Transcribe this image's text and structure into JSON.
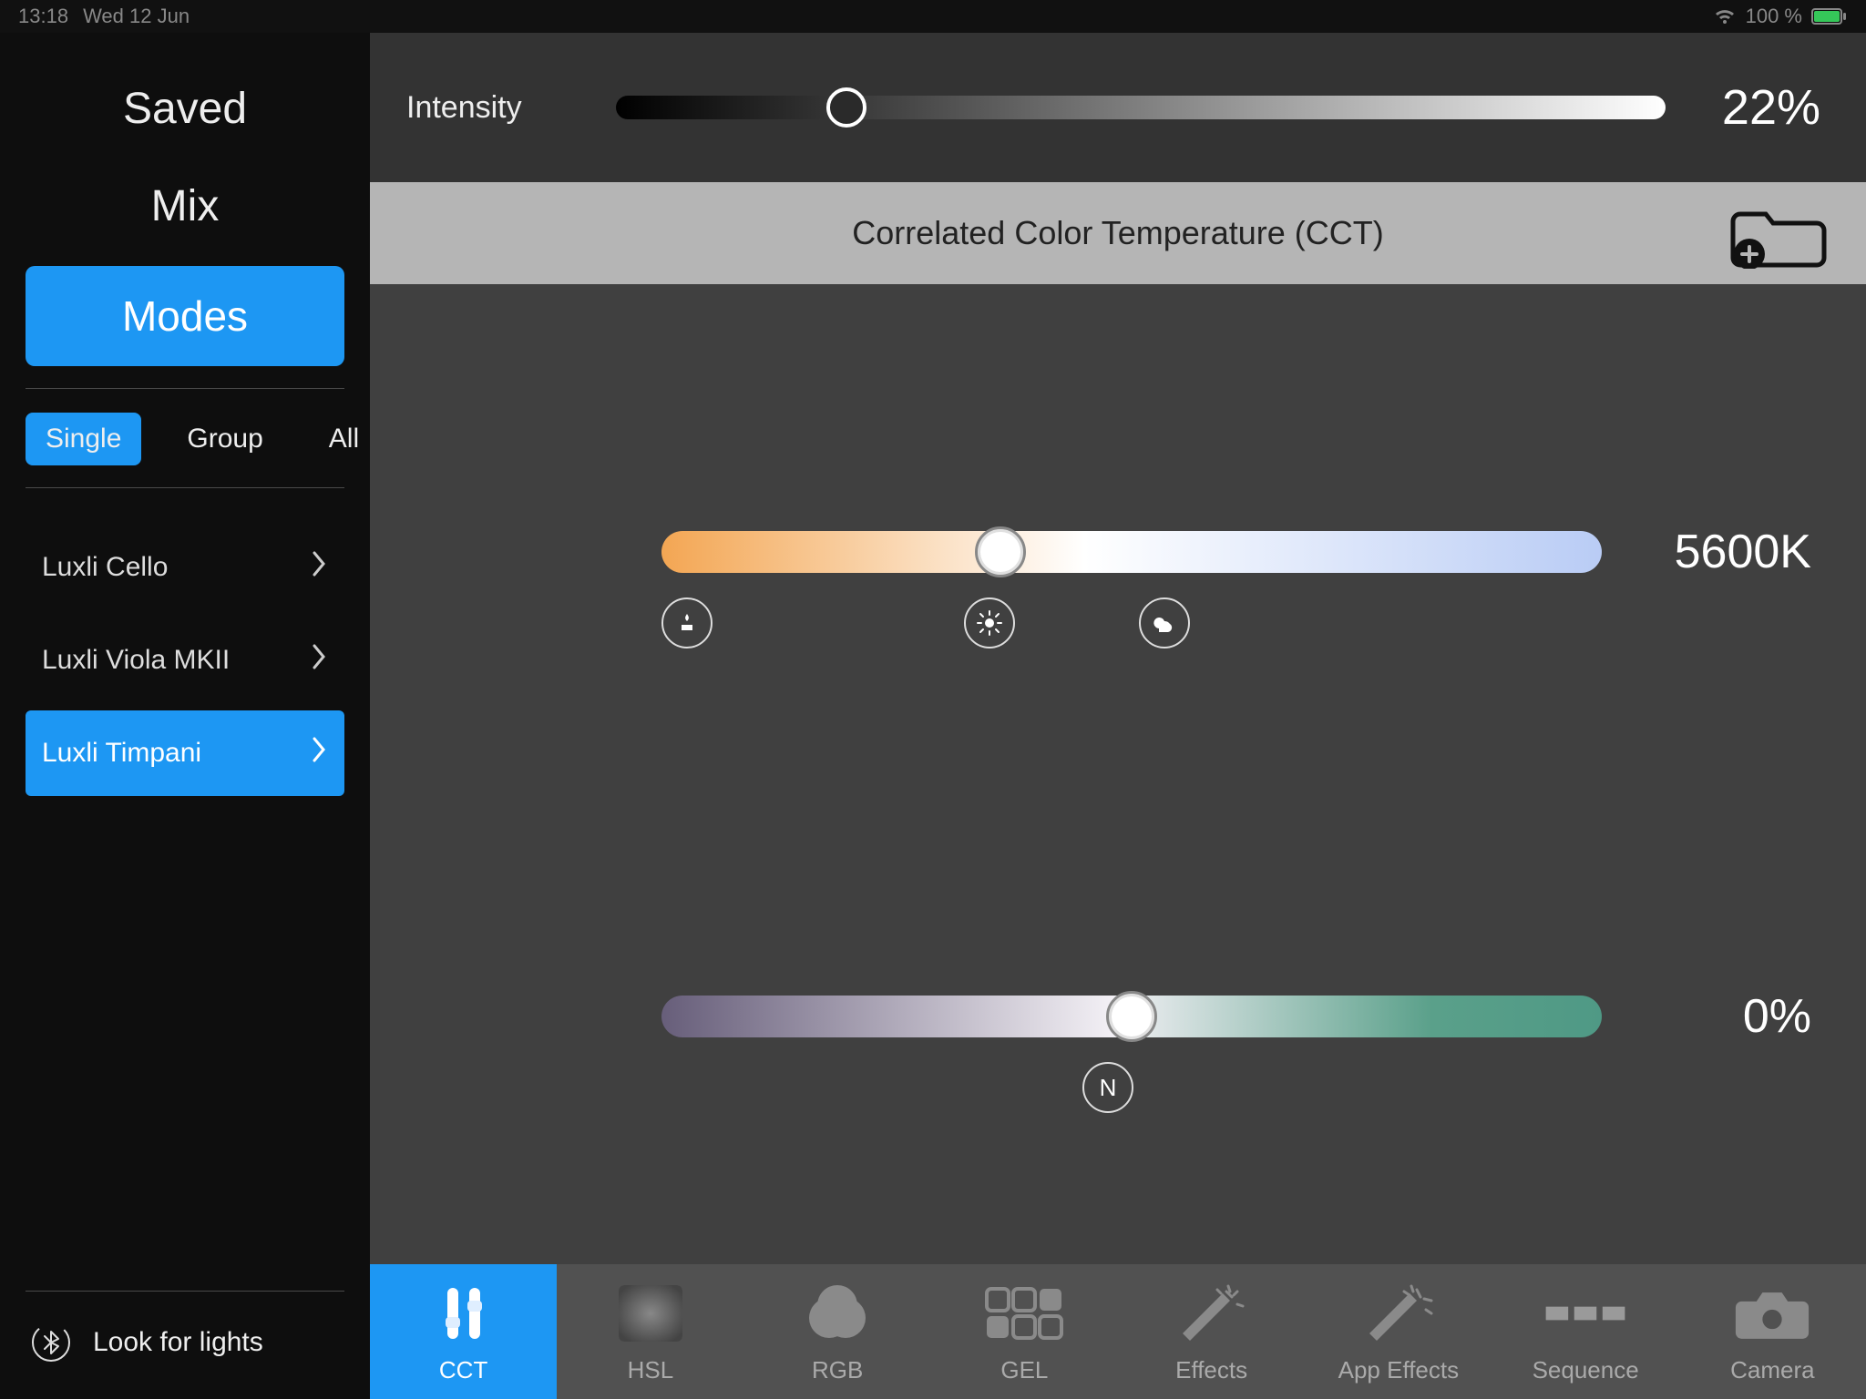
{
  "status": {
    "time": "13:18",
    "date": "Wed 12 Jun",
    "battery_text": "100 %"
  },
  "sidebar": {
    "nav": [
      {
        "label": "Saved",
        "active": false
      },
      {
        "label": "Mix",
        "active": false
      },
      {
        "label": "Modes",
        "active": true
      }
    ],
    "scopes": [
      {
        "label": "Single",
        "active": true
      },
      {
        "label": "Group",
        "active": false
      },
      {
        "label": "All",
        "active": false
      }
    ],
    "devices": [
      {
        "label": "Luxli Cello",
        "active": false
      },
      {
        "label": "Luxli Viola MKII",
        "active": false
      },
      {
        "label": "Luxli Timpani",
        "active": true
      }
    ],
    "look_label": "Look for lights"
  },
  "intensity": {
    "label": "Intensity",
    "percent": 22,
    "display": "22%"
  },
  "section": {
    "title": "Correlated Color Temperature (CCT)"
  },
  "cct": {
    "kelvin": 5600,
    "display": "5600K",
    "thumb_percent": 36,
    "icons": {
      "candle": "candle-icon",
      "sun": "sun-icon",
      "cloud": "cloud-icon"
    }
  },
  "tint": {
    "percent": 0,
    "display": "0%",
    "thumb_percent": 50,
    "neutral_label": "N"
  },
  "tabs": [
    {
      "label": "CCT",
      "icon": "sliders",
      "active": true
    },
    {
      "label": "HSL",
      "icon": "hsl",
      "active": false
    },
    {
      "label": "RGB",
      "icon": "venn",
      "active": false
    },
    {
      "label": "GEL",
      "icon": "grid",
      "active": false
    },
    {
      "label": "Effects",
      "icon": "wand",
      "active": false
    },
    {
      "label": "App Effects",
      "icon": "wand2",
      "active": false
    },
    {
      "label": "Sequence",
      "icon": "sequence",
      "active": false
    },
    {
      "label": "Camera",
      "icon": "camera",
      "active": false
    }
  ]
}
